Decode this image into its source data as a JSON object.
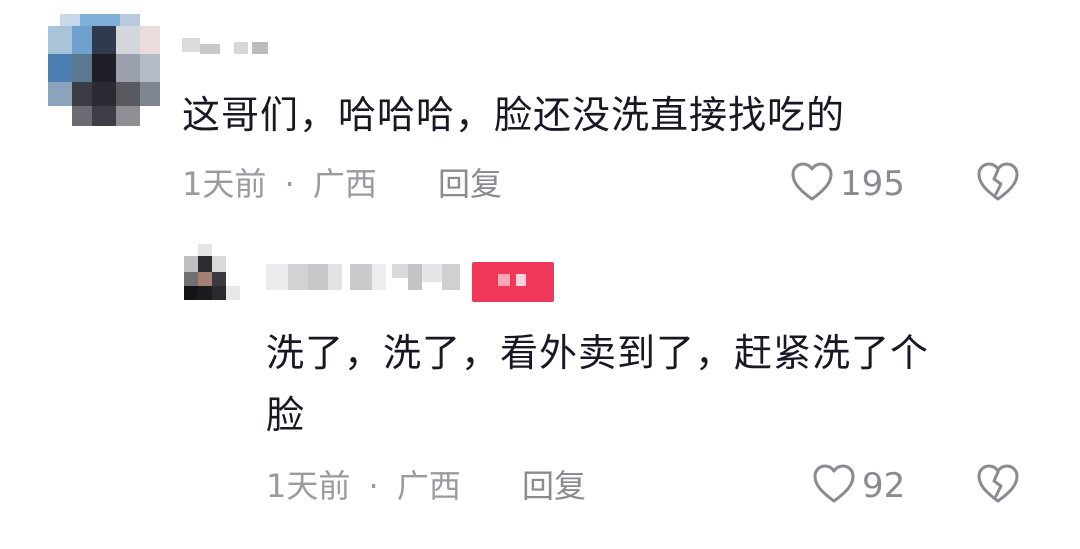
{
  "comments": [
    {
      "text": "这哥们，哈哈哈，脸还没洗直接找吃的",
      "time": "1天前",
      "separator": "·",
      "location": "广西",
      "reply_label": "回复",
      "likes": "195",
      "icons": {
        "like": "heart-outline-icon",
        "dislike": "broken-heart-icon"
      }
    },
    {
      "text_line1": "洗了，洗了，看外卖到了，赶紧洗了个",
      "text_line2": "脸",
      "time": "1天前",
      "separator": "·",
      "location": "广西",
      "reply_label": "回复",
      "likes": "92",
      "icons": {
        "like": "heart-outline-icon",
        "dislike": "broken-heart-icon"
      }
    }
  ],
  "colors": {
    "text_primary": "#161823",
    "text_meta": "#9a9aa0",
    "author_badge": "#f0385a"
  }
}
